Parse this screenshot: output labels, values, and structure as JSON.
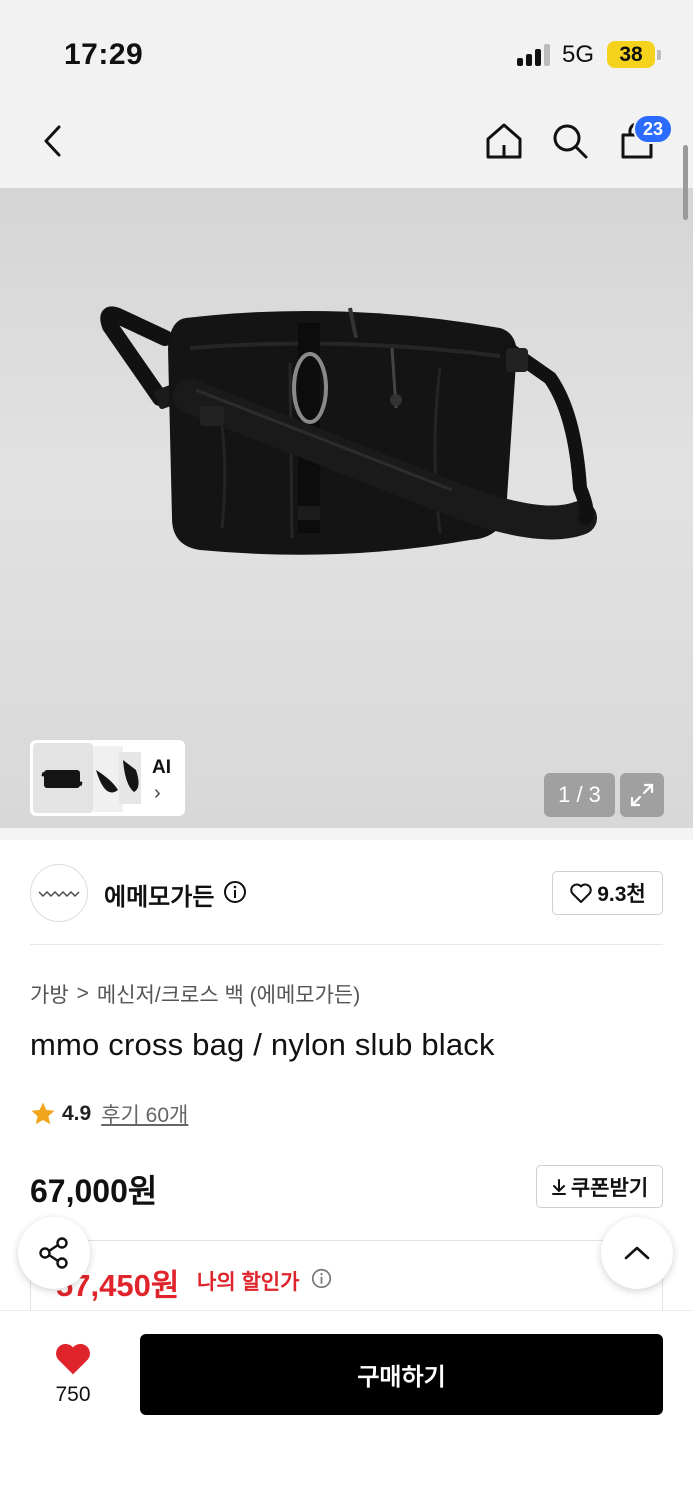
{
  "status_bar": {
    "time": "17:29",
    "network": "5G",
    "battery": "38"
  },
  "header": {
    "cart_count": "23",
    "icons": [
      "back-icon",
      "home-icon",
      "search-icon",
      "cart-icon"
    ]
  },
  "gallery": {
    "page_indicator": "1 / 3",
    "ai_label": "AI",
    "ai_chevron": "›"
  },
  "brand": {
    "name": "에메모가든",
    "likes": "9.3천"
  },
  "breadcrumb": {
    "category": "가방",
    "separator": ">",
    "subcategory": "메신저/크로스 백 (에메모가든)"
  },
  "product": {
    "title": "mmo cross bag / nylon slub black",
    "rating": "4.9",
    "reviews": "후기 60개",
    "price": "67,000원"
  },
  "coupon": {
    "label": "쿠폰받기"
  },
  "discount": {
    "price": "57,450원",
    "label": "나의 할인가"
  },
  "bottom": {
    "like_count": "750",
    "buy_label": "구매하기"
  },
  "colors": {
    "accent_red": "#e0242b",
    "badge_blue": "#2b6bff",
    "battery_yellow": "#f5d31c"
  }
}
